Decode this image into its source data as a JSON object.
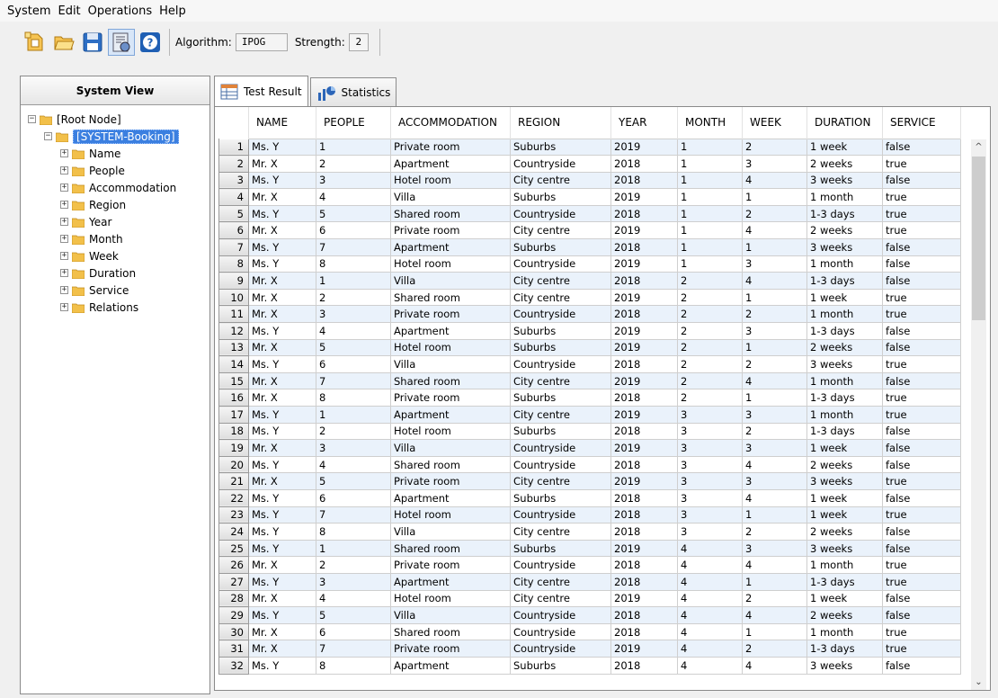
{
  "menu": [
    "System",
    "Edit",
    "Operations",
    "Help"
  ],
  "toolbar": {
    "algorithm_label": "Algorithm:",
    "algorithm_value": "IPOG",
    "strength_label": "Strength:",
    "strength_value": "2",
    "icons": [
      "new-system-icon",
      "open-folder-icon",
      "save-icon",
      "generate-icon",
      "help-icon"
    ]
  },
  "left_panel": {
    "title": "System View",
    "root": "[Root Node]",
    "system": "[SYSTEM-Booking]",
    "items": [
      "Name",
      "People",
      "Accommodation",
      "Region",
      "Year",
      "Month",
      "Week",
      "Duration",
      "Service",
      "Relations"
    ]
  },
  "tabs": [
    {
      "label": "Test Result",
      "active": true
    },
    {
      "label": "Statistics",
      "active": false
    }
  ],
  "table": {
    "columns": [
      "NAME",
      "PEOPLE",
      "ACCOMMODATION",
      "REGION",
      "YEAR",
      "MONTH",
      "WEEK",
      "DURATION",
      "SERVICE"
    ],
    "rows": [
      [
        "1",
        "Ms. Y",
        "1",
        "Private room",
        "Suburbs",
        "2019",
        "1",
        "2",
        "1 week",
        "false"
      ],
      [
        "2",
        "Mr. X",
        "2",
        "Apartment",
        "Countryside",
        "2018",
        "1",
        "3",
        "2 weeks",
        "true"
      ],
      [
        "3",
        "Ms. Y",
        "3",
        "Hotel room",
        "City centre",
        "2018",
        "1",
        "4",
        "3 weeks",
        "false"
      ],
      [
        "4",
        "Mr. X",
        "4",
        "Villa",
        "Suburbs",
        "2019",
        "1",
        "1",
        "1 month",
        "true"
      ],
      [
        "5",
        "Ms. Y",
        "5",
        "Shared room",
        "Countryside",
        "2018",
        "1",
        "2",
        "1-3 days",
        "true"
      ],
      [
        "6",
        "Mr. X",
        "6",
        "Private room",
        "City centre",
        "2019",
        "1",
        "4",
        "2 weeks",
        "true"
      ],
      [
        "7",
        "Ms. Y",
        "7",
        "Apartment",
        "Suburbs",
        "2018",
        "1",
        "1",
        "3 weeks",
        "false"
      ],
      [
        "8",
        "Ms. Y",
        "8",
        "Hotel room",
        "Countryside",
        "2019",
        "1",
        "3",
        "1 month",
        "false"
      ],
      [
        "9",
        "Mr. X",
        "1",
        "Villa",
        "City centre",
        "2018",
        "2",
        "4",
        "1-3 days",
        "false"
      ],
      [
        "10",
        "Mr. X",
        "2",
        "Shared room",
        "City centre",
        "2019",
        "2",
        "1",
        "1 week",
        "true"
      ],
      [
        "11",
        "Mr. X",
        "3",
        "Private room",
        "Countryside",
        "2018",
        "2",
        "2",
        "1 month",
        "true"
      ],
      [
        "12",
        "Ms. Y",
        "4",
        "Apartment",
        "Suburbs",
        "2019",
        "2",
        "3",
        "1-3 days",
        "false"
      ],
      [
        "13",
        "Mr. X",
        "5",
        "Hotel room",
        "Suburbs",
        "2019",
        "2",
        "1",
        "2 weeks",
        "false"
      ],
      [
        "14",
        "Ms. Y",
        "6",
        "Villa",
        "Countryside",
        "2018",
        "2",
        "2",
        "3 weeks",
        "true"
      ],
      [
        "15",
        "Mr. X",
        "7",
        "Shared room",
        "City centre",
        "2019",
        "2",
        "4",
        "1 month",
        "false"
      ],
      [
        "16",
        "Mr. X",
        "8",
        "Private room",
        "Suburbs",
        "2018",
        "2",
        "1",
        "1-3 days",
        "true"
      ],
      [
        "17",
        "Ms. Y",
        "1",
        "Apartment",
        "City centre",
        "2019",
        "3",
        "3",
        "1 month",
        "true"
      ],
      [
        "18",
        "Ms. Y",
        "2",
        "Hotel room",
        "Suburbs",
        "2018",
        "3",
        "2",
        "1-3 days",
        "false"
      ],
      [
        "19",
        "Mr. X",
        "3",
        "Villa",
        "Countryside",
        "2019",
        "3",
        "3",
        "1 week",
        "false"
      ],
      [
        "20",
        "Ms. Y",
        "4",
        "Shared room",
        "Countryside",
        "2018",
        "3",
        "4",
        "2 weeks",
        "false"
      ],
      [
        "21",
        "Mr. X",
        "5",
        "Private room",
        "City centre",
        "2019",
        "3",
        "3",
        "3 weeks",
        "true"
      ],
      [
        "22",
        "Ms. Y",
        "6",
        "Apartment",
        "Suburbs",
        "2018",
        "3",
        "4",
        "1 week",
        "false"
      ],
      [
        "23",
        "Ms. Y",
        "7",
        "Hotel room",
        "Countryside",
        "2018",
        "3",
        "1",
        "1 week",
        "true"
      ],
      [
        "24",
        "Ms. Y",
        "8",
        "Villa",
        "City centre",
        "2018",
        "3",
        "2",
        "2 weeks",
        "false"
      ],
      [
        "25",
        "Ms. Y",
        "1",
        "Shared room",
        "Suburbs",
        "2019",
        "4",
        "3",
        "3 weeks",
        "false"
      ],
      [
        "26",
        "Mr. X",
        "2",
        "Private room",
        "Countryside",
        "2018",
        "4",
        "4",
        "1 month",
        "true"
      ],
      [
        "27",
        "Ms. Y",
        "3",
        "Apartment",
        "City centre",
        "2018",
        "4",
        "1",
        "1-3 days",
        "true"
      ],
      [
        "28",
        "Mr. X",
        "4",
        "Hotel room",
        "City centre",
        "2019",
        "4",
        "2",
        "1 week",
        "false"
      ],
      [
        "29",
        "Ms. Y",
        "5",
        "Villa",
        "Countryside",
        "2018",
        "4",
        "4",
        "2 weeks",
        "false"
      ],
      [
        "30",
        "Mr. X",
        "6",
        "Shared room",
        "Countryside",
        "2018",
        "4",
        "1",
        "1 month",
        "true"
      ],
      [
        "31",
        "Mr. X",
        "7",
        "Private room",
        "Countryside",
        "2019",
        "4",
        "2",
        "1-3 days",
        "true"
      ],
      [
        "32",
        "Ms. Y",
        "8",
        "Apartment",
        "Suburbs",
        "2018",
        "4",
        "4",
        "3 weeks",
        "false"
      ]
    ]
  }
}
